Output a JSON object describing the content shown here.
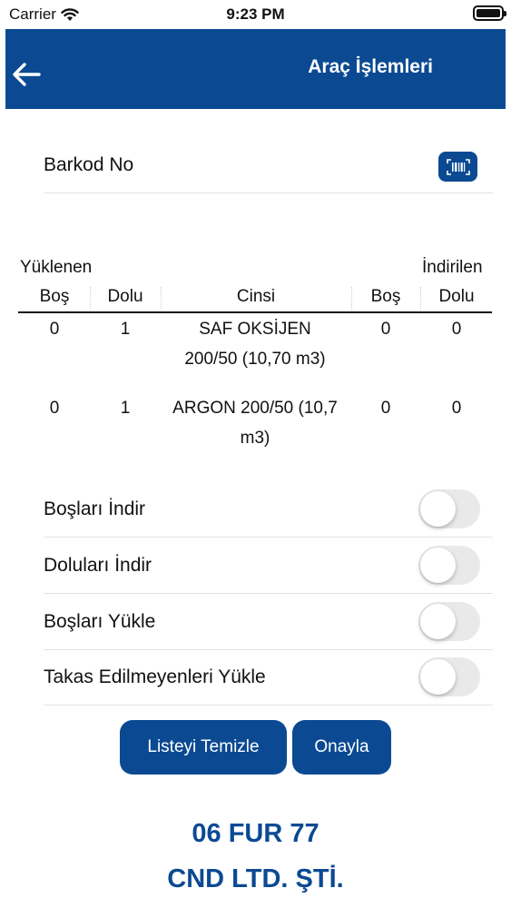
{
  "status_bar": {
    "carrier": "Carrier",
    "time": "9:23 PM"
  },
  "header": {
    "title": "Araç İşlemleri",
    "back_icon": "arrow-left-icon"
  },
  "barcode": {
    "label": "Barkod No",
    "icon": "barcode-scan-icon"
  },
  "table": {
    "group_left": "Yüklenen",
    "group_right": "İndirilen",
    "columns": [
      "Boş",
      "Dolu",
      "Cinsi",
      "Boş",
      "Dolu"
    ],
    "rows": [
      {
        "yuk_bos": "0",
        "yuk_dolu": "1",
        "cins_1": "SAF OKSİJEN",
        "cins_2": "200/50 (10,70 m3)",
        "ind_bos": "0",
        "ind_dolu": "0"
      },
      {
        "yuk_bos": "0",
        "yuk_dolu": "1",
        "cins_1": "ARGON 200/50 (10,7",
        "cins_2": "m3)",
        "ind_bos": "0",
        "ind_dolu": "0"
      }
    ]
  },
  "toggles": [
    {
      "label": "Boşları İndir",
      "on": false
    },
    {
      "label": "Doluları İndir",
      "on": false
    },
    {
      "label": "Boşları Yükle",
      "on": false
    },
    {
      "label": "Takas Edilmeyenleri Yükle",
      "on": false
    }
  ],
  "buttons": {
    "clear": "Listeyi Temizle",
    "confirm": "Onayla"
  },
  "footer": {
    "plate": "06 FUR 77",
    "company": "CND LTD. ŞTİ."
  },
  "colors": {
    "primary": "#0b4a93",
    "toggle_off": "#e9e9ea"
  }
}
